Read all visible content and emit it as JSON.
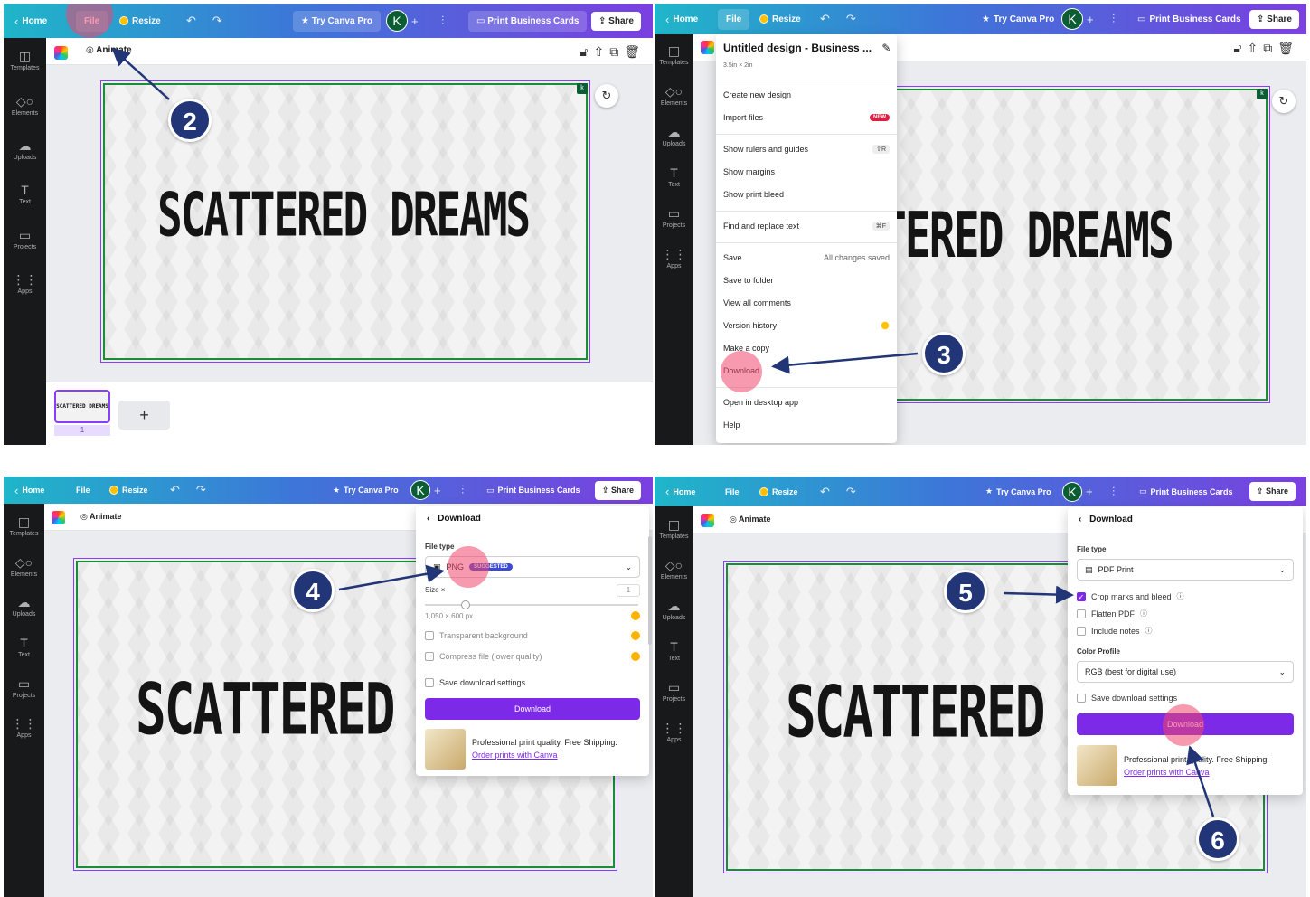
{
  "topbar": {
    "home": "Home",
    "file": "File",
    "resize": "Resize",
    "try_pro": "Try Canva Pro",
    "avatar": "K",
    "print_cards": "Print Business Cards",
    "share": "Share"
  },
  "sidebar": {
    "items": [
      {
        "label": "Templates",
        "icon": "templates-icon"
      },
      {
        "label": "Elements",
        "icon": "elements-icon"
      },
      {
        "label": "Uploads",
        "icon": "uploads-icon"
      },
      {
        "label": "Text",
        "icon": "text-icon"
      },
      {
        "label": "Projects",
        "icon": "projects-icon"
      },
      {
        "label": "Apps",
        "icon": "apps-icon"
      }
    ]
  },
  "editor": {
    "animate": "Animate",
    "canvas_text": "SCATTERED DREAMS",
    "canvas_text_clip3": "SCATTERED D",
    "canvas_text_clip2": "TERED DREAMS",
    "k_badge": "k",
    "page_number": "1",
    "add_page": "+"
  },
  "file_menu": {
    "title": "Untitled design - Business ...",
    "size": "3.5in × 2in",
    "items": {
      "create": "Create new design",
      "import": "Import files",
      "import_badge": "NEW",
      "rulers": "Show rulers and guides",
      "rulers_key": "⇧R",
      "margins": "Show margins",
      "bleed": "Show print bleed",
      "find": "Find and replace text",
      "find_key": "⌘F",
      "save": "Save",
      "save_status": "All changes saved",
      "save_folder": "Save to folder",
      "comments": "View all comments",
      "version": "Version history",
      "copy": "Make a copy",
      "download": "Download",
      "desktop": "Open in desktop app",
      "help": "Help"
    }
  },
  "download_png": {
    "header": "Download",
    "file_type_label": "File type",
    "file_type": "PNG",
    "suggested": "SUGGESTED",
    "size_label": "Size ×",
    "size_value": "1",
    "dimensions": "1,050 × 600 px",
    "transparent": "Transparent background",
    "compress": "Compress file (lower quality)",
    "save_settings": "Save download settings",
    "button": "Download",
    "promo_text": "Professional print quality. Free Shipping.",
    "promo_link": "Order prints with Canva"
  },
  "download_pdf": {
    "header": "Download",
    "file_type_label": "File type",
    "file_type": "PDF Print",
    "crop_marks": "Crop marks and bleed",
    "crop_marks_checked": true,
    "flatten": "Flatten PDF",
    "notes": "Include notes",
    "color_profile_label": "Color Profile",
    "color_profile": "RGB (best for digital use)",
    "save_settings": "Save download settings",
    "button": "Download",
    "promo_text": "Professional print quality. Free Shipping.",
    "promo_link": "Order prints with Canva"
  },
  "steps": [
    "2",
    "3",
    "4",
    "5",
    "6"
  ],
  "colors": {
    "accent": "#7d2ae8",
    "step_badge": "#223577",
    "highlight": "#f0466e",
    "canvas_border": "#1a8c3a"
  }
}
